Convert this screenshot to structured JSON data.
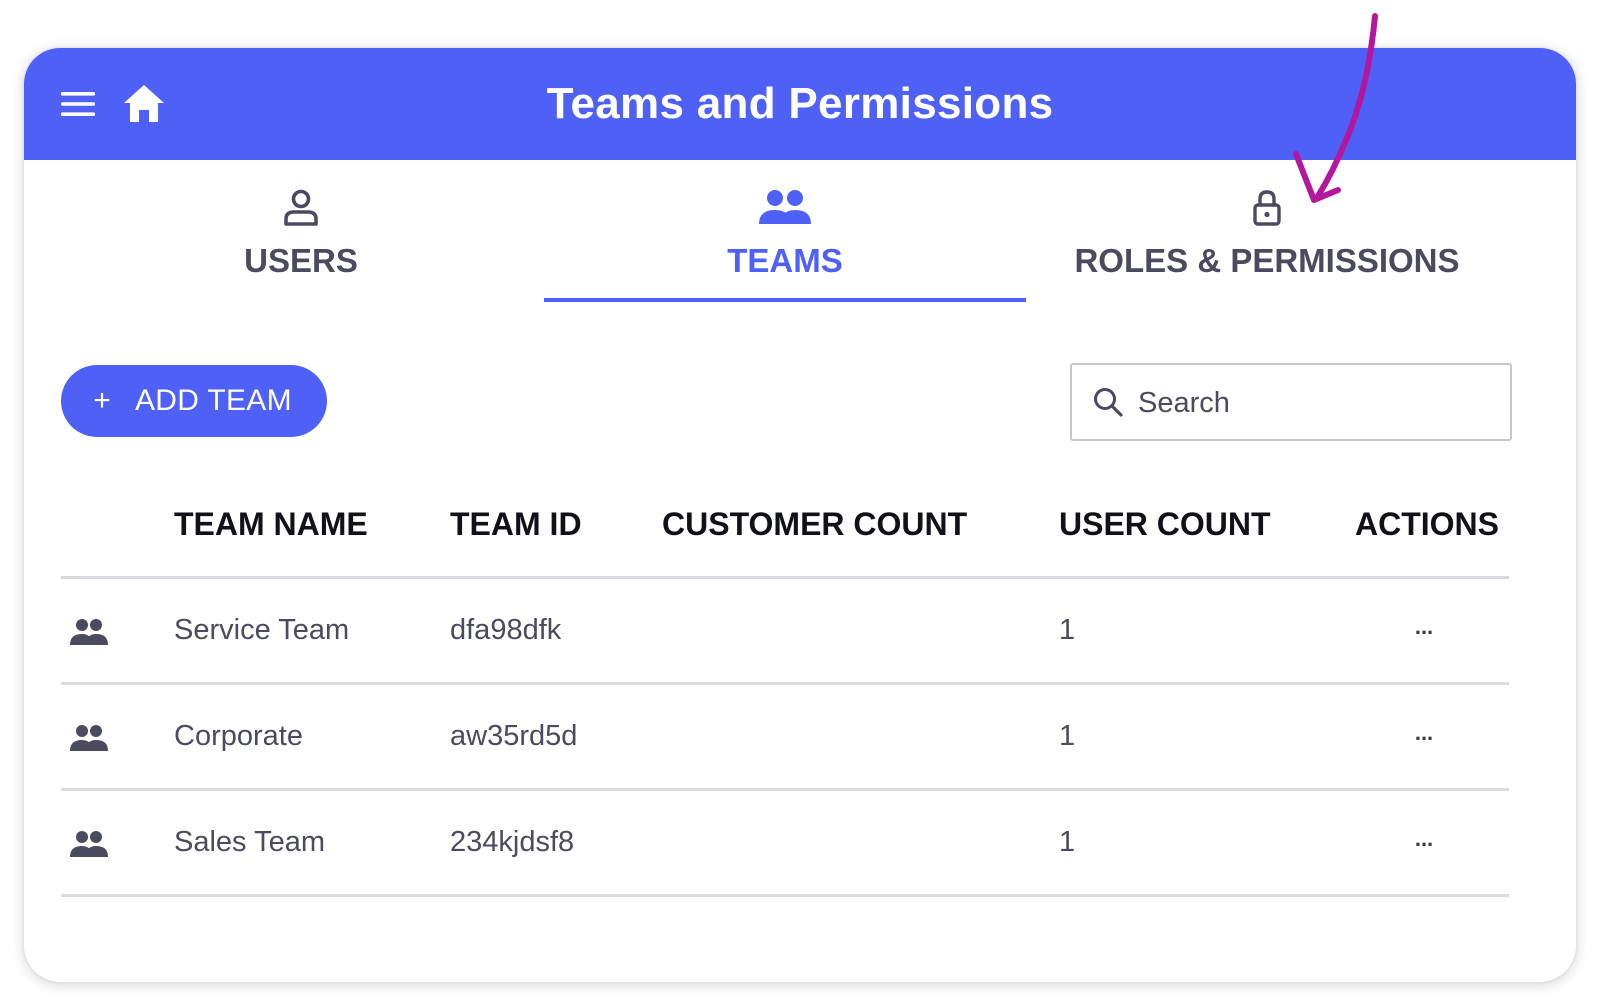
{
  "header": {
    "title": "Teams and Permissions",
    "menu_icon": "hamburger-menu-icon",
    "home_icon": "home-icon",
    "background_color": "#4f60f7"
  },
  "tabs": [
    {
      "label": "USERS",
      "icon": "user-icon",
      "active": false
    },
    {
      "label": "TEAMS",
      "icon": "users-group-icon",
      "active": true
    },
    {
      "label": "ROLES & PERMISSIONS",
      "icon": "lock-icon",
      "active": false
    }
  ],
  "toolbar": {
    "add_icon": "plus",
    "add_label": "ADD TEAM",
    "search_placeholder": "Search",
    "search_value": ""
  },
  "table": {
    "columns": [
      "TEAM NAME",
      "TEAM ID",
      "CUSTOMER COUNT",
      "USER COUNT",
      "ACTIONS"
    ],
    "rows": [
      {
        "icon": "team-icon",
        "name": "Service Team",
        "id": "dfa98dfk",
        "customers": "",
        "users": "1",
        "actions": "..."
      },
      {
        "icon": "team-icon",
        "name": "Corporate",
        "id": "aw35rd5d",
        "customers": "",
        "users": "1",
        "actions": "..."
      },
      {
        "icon": "team-icon",
        "name": "Sales Team",
        "id": "234kjdsf8",
        "customers": "",
        "users": "1",
        "actions": "..."
      }
    ]
  },
  "annotation": {
    "type": "arrow",
    "points_to": "ROLES & PERMISSIONS",
    "color": "#b3179e"
  },
  "colors": {
    "accent": "#4f60f7",
    "text": "#4a4b5e",
    "heading": "#111118",
    "divider": "#d8d8dc"
  }
}
